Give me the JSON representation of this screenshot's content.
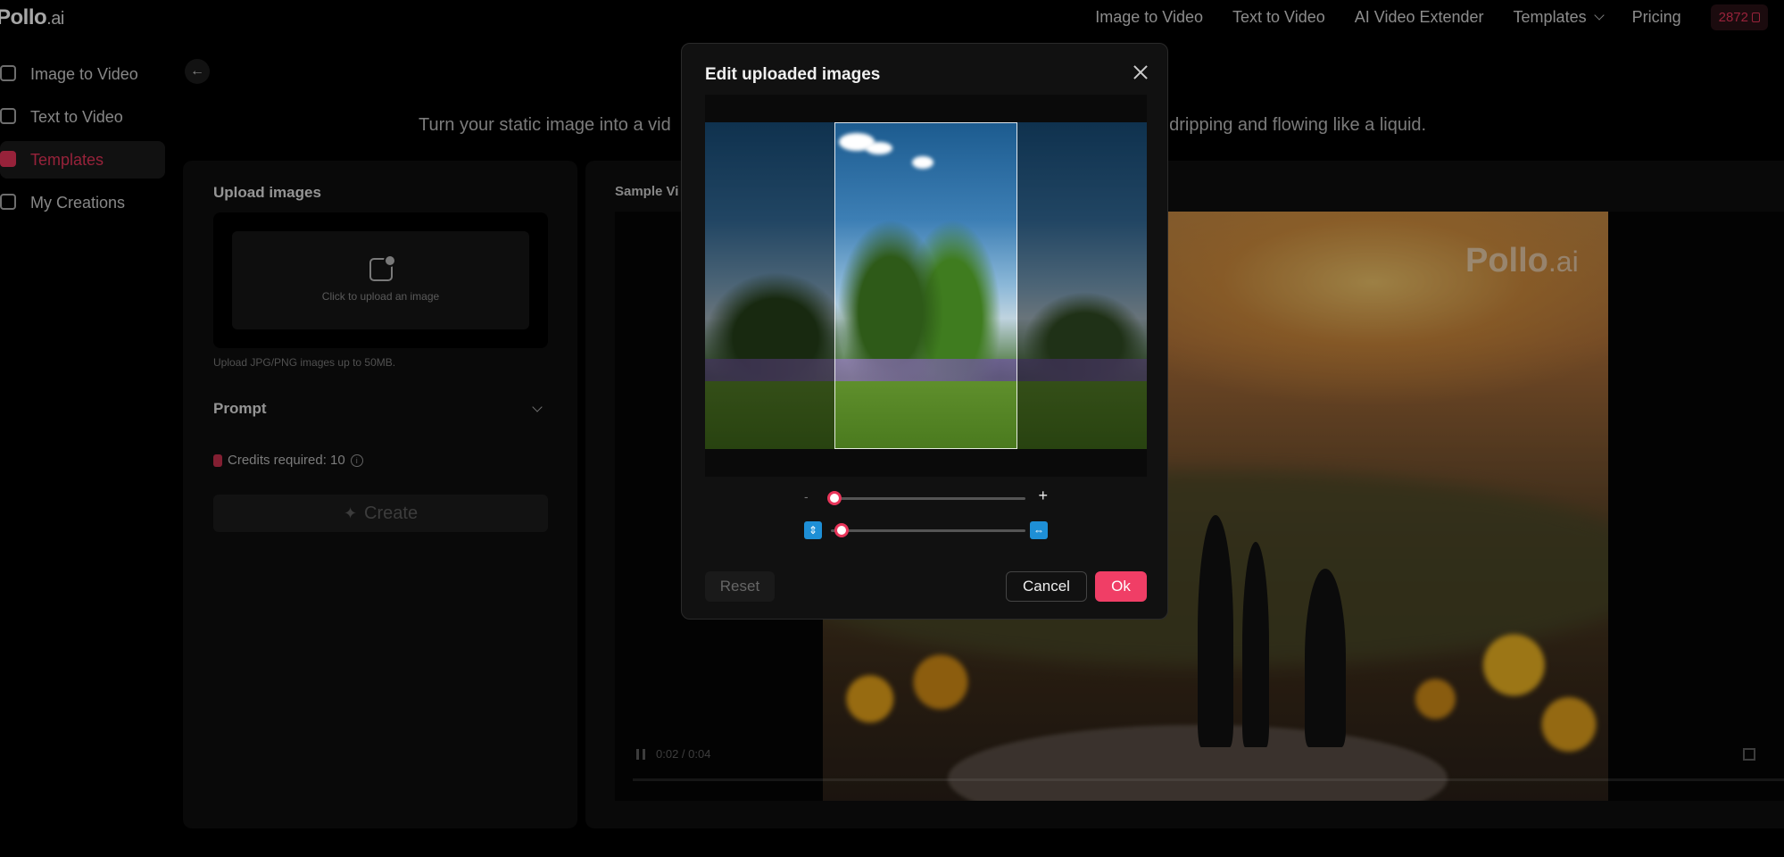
{
  "app": {
    "logo_main": "Pollo",
    "logo_suffix": ".ai"
  },
  "nav": {
    "items": [
      "Image to Video",
      "Text to Video",
      "AI Video Extender",
      "Templates",
      "Pricing"
    ],
    "credits": "2872"
  },
  "sidebar": {
    "items": [
      {
        "label": "Image to Video",
        "icon": "image-video-icon"
      },
      {
        "label": "Text to Video",
        "icon": "text-video-icon"
      },
      {
        "label": "Templates",
        "icon": "templates-icon",
        "active": true
      },
      {
        "label": "My Creations",
        "icon": "folder-icon"
      }
    ]
  },
  "page": {
    "description": "Turn your static image into a vid                                                                     appear as if they're dripping and flowing like a liquid."
  },
  "left_panel": {
    "upload_title": "Upload images",
    "upload_cta": "Click to upload an image",
    "upload_hint": "Upload JPG/PNG images up to 50MB.",
    "prompt_label": "Prompt",
    "credits_required": "Credits required: 10",
    "create_label": "Create"
  },
  "right_panel": {
    "sample_label": "Sample Vi",
    "watermark_main": "Pollo",
    "watermark_suffix": ".ai",
    "time": "0:02 / 0:04"
  },
  "modal": {
    "title": "Edit uploaded images",
    "zoom_minus": "-",
    "zoom_plus": "+",
    "reset_label": "Reset",
    "cancel_label": "Cancel",
    "ok_label": "Ok",
    "zoom_level": 0.0,
    "aspect_level": 0.0
  },
  "colors": {
    "accent": "#e8355a",
    "ok_button": "#f03e66",
    "fit_icon": "#1e8fd6"
  }
}
